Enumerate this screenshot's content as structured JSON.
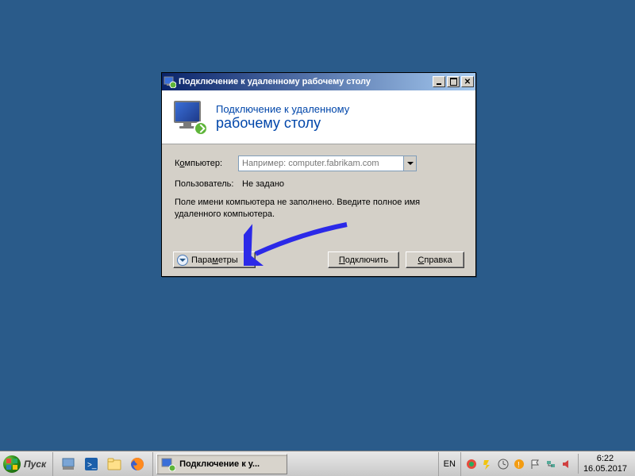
{
  "dialog": {
    "title": "Подключение к удаленному рабочему столу",
    "banner_line1": "Подключение к удаленному",
    "banner_line2": "рабочему столу",
    "computer_label_pre": "К",
    "computer_label_u": "о",
    "computer_label_post": "мпьютер:",
    "computer_placeholder": "Например: computer.fabrikam.com",
    "user_label": "Пользователь:",
    "user_value": "Не задано",
    "hint": "Поле имени компьютера не заполнено. Введите полное имя удаленного компьютера.",
    "params_pre": "Пара",
    "params_u": "м",
    "params_post": "етры",
    "connect_pre": "",
    "connect_u": "П",
    "connect_post": "одключить",
    "help_pre": "",
    "help_u": "С",
    "help_post": "правка"
  },
  "taskbar": {
    "start": "Пуск",
    "task_button": "Подключение к у...",
    "lang": "EN",
    "time": "6:22",
    "date": "16.05.2017"
  }
}
